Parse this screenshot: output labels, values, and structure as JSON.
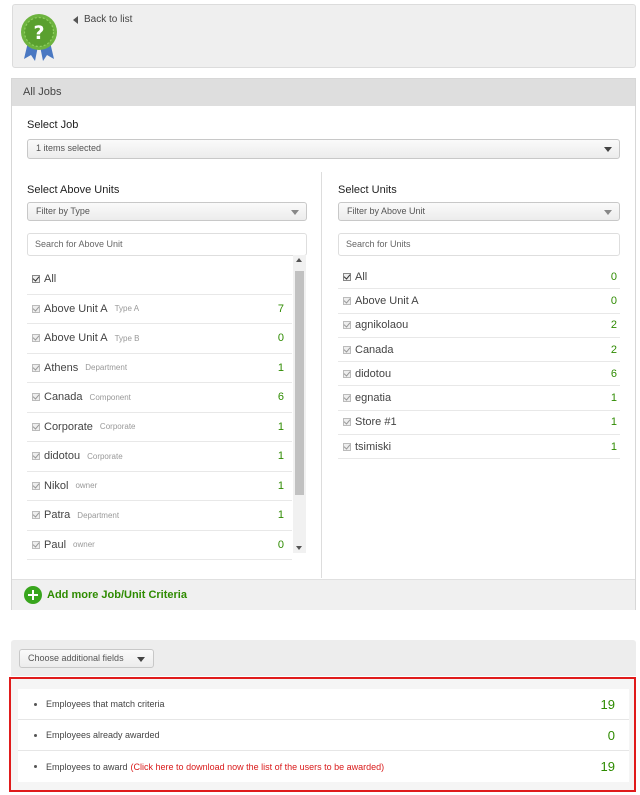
{
  "header": {
    "back_label": "Back to list",
    "badge_icon": "question-badge-icon"
  },
  "panel": {
    "title": "All Jobs",
    "select_job_label": "Select Job",
    "select_job_value": "1 items selected",
    "left": {
      "title": "Select Above Units",
      "filter_placeholder": "Filter by Type",
      "search_placeholder": "Search for Above Unit",
      "items": [
        {
          "name": "All",
          "type": "",
          "count": ""
        },
        {
          "name": "Above Unit A",
          "type": "Type A",
          "count": "7"
        },
        {
          "name": "Above Unit A",
          "type": "Type B",
          "count": "0"
        },
        {
          "name": "Athens",
          "type": "Department",
          "count": "1"
        },
        {
          "name": "Canada",
          "type": "Component",
          "count": "6"
        },
        {
          "name": "Corporate",
          "type": "Corporate",
          "count": "1"
        },
        {
          "name": "didotou",
          "type": "Corporate",
          "count": "1"
        },
        {
          "name": "Nikol",
          "type": "owner",
          "count": "1"
        },
        {
          "name": "Patra",
          "type": "Department",
          "count": "1"
        },
        {
          "name": "Paul",
          "type": "owner",
          "count": "0"
        }
      ]
    },
    "right": {
      "title": "Select Units",
      "filter_placeholder": "Filter by Above Unit",
      "search_placeholder": "Search for Units",
      "items": [
        {
          "name": "All",
          "count": "0"
        },
        {
          "name": "Above Unit A",
          "count": "0"
        },
        {
          "name": "agnikolaou",
          "count": "2"
        },
        {
          "name": "Canada",
          "count": "2"
        },
        {
          "name": "didotou",
          "count": "6"
        },
        {
          "name": "egnatia",
          "count": "1"
        },
        {
          "name": "Store #1",
          "count": "1"
        },
        {
          "name": "tsimiski",
          "count": "1"
        }
      ]
    },
    "add_more_label": "Add more Job/Unit Criteria"
  },
  "additional_fields_label": "Choose additional fields",
  "summary": {
    "match_label": "Employees that match criteria",
    "match_count": "19",
    "awarded_label": "Employees already awarded",
    "awarded_count": "0",
    "to_award_label": "Employees to award",
    "download_link": "(Click here to download now the list of the users to be awarded)",
    "to_award_count": "19"
  },
  "colors": {
    "accent_green": "#2e8b00",
    "alert_red": "#e01b1b"
  }
}
